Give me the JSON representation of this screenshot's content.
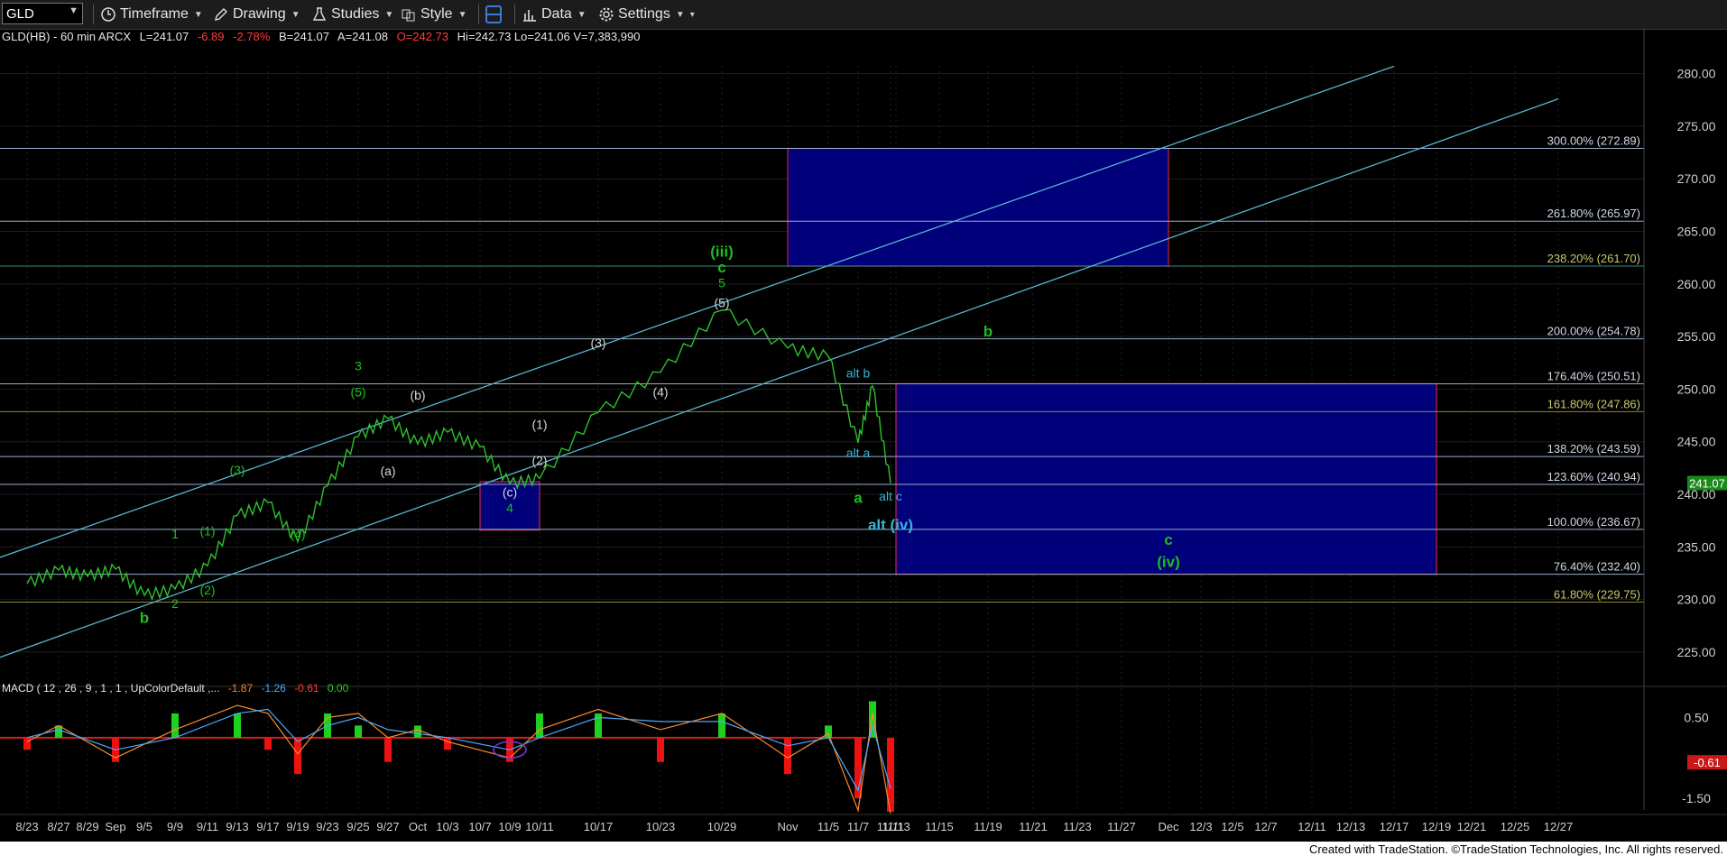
{
  "toolbar": {
    "symbol": "GLD",
    "timeframe": "Timeframe",
    "drawing": "Drawing",
    "studies": "Studies",
    "style": "Style",
    "data": "Data",
    "settings": "Settings"
  },
  "header": {
    "instrument": "GLD(HB) - 60 min  ARCX",
    "last": "L=241.07",
    "change": "-6.89",
    "pct": "-2.78%",
    "bid": "B=241.07",
    "ask": "A=241.08",
    "open": "O=242.73",
    "rest": "Hi=242.73  Lo=241.06  V=7,383,990"
  },
  "macd_header": {
    "name": "MACD ( 12 , 26 , 9 , 1 , 1 , UpColorDefault ,...",
    "v1": "-1.87",
    "v2": "-1.26",
    "v3": "-0.61",
    "v4": "0.00"
  },
  "colors": {
    "price_up": "#2dc12d",
    "fib_line": "#9aaecb",
    "box_fill": "#00007a",
    "box_border": "#cc2244",
    "wave_green": "#1fbd1f",
    "wave_cyan": "#36b6d8",
    "label_gray": "#d8d8d8",
    "macd_pos": "#1fd11f",
    "macd_neg": "#ee1111"
  },
  "chart_data": {
    "type": "line",
    "title": "GLD(HB) - 60 min",
    "ylim": [
      220,
      282
    ],
    "y_ticks": [
      225,
      230,
      235,
      240,
      245,
      250,
      255,
      260,
      265,
      270,
      275,
      280
    ],
    "x_ticks": [
      "8/23",
      "8/27",
      "8/29",
      "Sep",
      "9/5",
      "9/9",
      "9/11",
      "9/13",
      "9/17",
      "9/19",
      "9/23",
      "9/25",
      "9/27",
      "Oct",
      "10/3",
      "10/7",
      "10/9",
      "10/11",
      "10/17",
      "10/23",
      "10/29",
      "Nov",
      "11/5",
      "11/7",
      "11/11",
      "11/13",
      "11/15",
      "11/19",
      "11/21",
      "11/23",
      "11/27",
      "Dec",
      "12/3",
      "12/5",
      "12/7",
      "12/11",
      "12/13",
      "12/17",
      "12/19",
      "12/21",
      "12/25",
      "12/27"
    ],
    "last_price": "241.07",
    "price_path": [
      [
        "8/23",
        231.5
      ],
      [
        "8/27",
        232.8
      ],
      [
        "8/29",
        232.2
      ],
      [
        "Sep",
        232.9
      ],
      [
        "9/5",
        230.4
      ],
      [
        "9/9",
        231.0
      ],
      [
        "9/11",
        233.2
      ],
      [
        "9/13",
        238.0
      ],
      [
        "9/17",
        239.2
      ],
      [
        "9/19",
        235.5
      ],
      [
        "9/23",
        240.8
      ],
      [
        "9/25",
        245.5
      ],
      [
        "9/27",
        247.2
      ],
      [
        "Oct",
        244.8
      ],
      [
        "10/3",
        245.9
      ],
      [
        "10/7",
        244.5
      ],
      [
        "10/9",
        241.0
      ],
      [
        "10/11",
        241.5
      ],
      [
        "10/17",
        247.8
      ],
      [
        "10/23",
        251.6
      ],
      [
        "10/29",
        257.5
      ],
      [
        "Nov",
        253.9
      ],
      [
        "11/5",
        253.1
      ],
      [
        "11/7",
        244.9
      ],
      [
        "11/7",
        250.3
      ],
      [
        "11/11",
        241.07
      ]
    ],
    "fib_levels": [
      {
        "label": "300.00% (272.89)",
        "value": 272.89
      },
      {
        "label": "261.80% (265.97)",
        "value": 265.97
      },
      {
        "label": "238.20% (261.70)",
        "value": 261.7
      },
      {
        "label": "200.00% (254.78)",
        "value": 254.78
      },
      {
        "label": "176.40% (250.51)",
        "value": 250.51
      },
      {
        "label": "161.80% (247.86)",
        "value": 247.86
      },
      {
        "label": "138.20% (243.59)",
        "value": 243.59
      },
      {
        "label": "123.60% (240.94)",
        "value": 240.94
      },
      {
        "label": "100.00% (236.67)",
        "value": 236.67
      },
      {
        "label": "76.40% (232.40)",
        "value": 232.4
      },
      {
        "label": "61.80% (229.75)",
        "value": 229.75
      }
    ],
    "target_boxes": [
      {
        "from": "Nov",
        "to": "Dec",
        "low": 261.7,
        "high": 272.89
      },
      {
        "from": "11/13",
        "to": "12/19",
        "low": 232.4,
        "high": 250.51
      },
      {
        "from": "10/7",
        "to": "10/11",
        "low": 236.6,
        "high": 241.2
      }
    ],
    "channel_lines": [
      {
        "from": [
          "8/23",
          234
        ],
        "to": [
          "12/17",
          280.7
        ]
      },
      {
        "from": [
          "8/23",
          224.5
        ],
        "to": [
          "12/27",
          277.6
        ]
      }
    ],
    "wave_labels": [
      {
        "text": "b",
        "x": "9/5",
        "y": 227.8,
        "color": "green",
        "bold": true
      },
      {
        "text": "1",
        "x": "9/9",
        "y": 235.8,
        "color": "green",
        "bold": false
      },
      {
        "text": "2",
        "x": "9/9",
        "y": 229.2,
        "color": "green",
        "bold": false
      },
      {
        "text": "(1)",
        "x": "9/11",
        "y": 236.1,
        "color": "green",
        "bold": false
      },
      {
        "text": "(2)",
        "x": "9/11",
        "y": 230.5,
        "color": "green",
        "bold": false
      },
      {
        "text": "(3)",
        "x": "9/13",
        "y": 241.9,
        "color": "green",
        "bold": false
      },
      {
        "text": "(4)",
        "x": "9/19",
        "y": 235.8,
        "color": "green",
        "bold": false
      },
      {
        "text": "(5)",
        "x": "9/25",
        "y": 249.3,
        "color": "green",
        "bold": false
      },
      {
        "text": "3",
        "x": "9/25",
        "y": 251.8,
        "color": "green",
        "bold": false
      },
      {
        "text": "(a)",
        "x": "9/27",
        "y": 241.8,
        "color": "gray",
        "bold": false
      },
      {
        "text": "(b)",
        "x": "Oct",
        "y": 249.0,
        "color": "gray",
        "bold": false
      },
      {
        "text": "(c)",
        "x": "10/9",
        "y": 239.8,
        "color": "gray",
        "bold": false
      },
      {
        "text": "4",
        "x": "10/9",
        "y": 238.3,
        "color": "green",
        "bold": false
      },
      {
        "text": "(1)",
        "x": "10/11",
        "y": 246.2,
        "color": "gray",
        "bold": false
      },
      {
        "text": "(2)",
        "x": "10/11",
        "y": 242.8,
        "color": "gray",
        "bold": false
      },
      {
        "text": "(3)",
        "x": "10/17",
        "y": 254.0,
        "color": "gray",
        "bold": false
      },
      {
        "text": "(4)",
        "x": "10/23",
        "y": 249.3,
        "color": "gray",
        "bold": false
      },
      {
        "text": "(5)",
        "x": "10/29",
        "y": 257.8,
        "color": "gray",
        "bold": false
      },
      {
        "text": "5",
        "x": "10/29",
        "y": 259.7,
        "color": "green",
        "bold": false
      },
      {
        "text": "c",
        "x": "10/29",
        "y": 261.1,
        "color": "green",
        "bold": true
      },
      {
        "text": "(iii)",
        "x": "10/29",
        "y": 262.6,
        "color": "green",
        "bold": true
      },
      {
        "text": "alt b",
        "x": "11/7",
        "y": 251.1,
        "color": "cyan",
        "bold": false
      },
      {
        "text": "alt a",
        "x": "11/7",
        "y": 243.5,
        "color": "cyan",
        "bold": false
      },
      {
        "text": "a",
        "x": "11/7",
        "y": 239.2,
        "color": "green",
        "bold": true
      },
      {
        "text": "alt c",
        "x": "11/11",
        "y": 239.4,
        "color": "cyan",
        "bold": false
      },
      {
        "text": "alt (iv)",
        "x": "11/11",
        "y": 236.6,
        "color": "cyan",
        "bold": true
      },
      {
        "text": "b",
        "x": "11/19",
        "y": 255.0,
        "color": "green",
        "bold": true
      },
      {
        "text": "c",
        "x": "Dec",
        "y": 235.2,
        "color": "green",
        "bold": true
      },
      {
        "text": "(iv)",
        "x": "Dec",
        "y": 233.1,
        "color": "green",
        "bold": true
      }
    ],
    "macd": {
      "ylim": [
        -1.9,
        1.0
      ],
      "y_ticks": [
        0.5,
        -1.5
      ],
      "last_label": "-0.61",
      "macd_path": [
        [
          "8/23",
          -0.1
        ],
        [
          "8/27",
          0.3
        ],
        [
          "Sep",
          -0.5
        ],
        [
          "9/9",
          0.2
        ],
        [
          "9/13",
          0.8
        ],
        [
          "9/17",
          0.6
        ],
        [
          "9/19",
          -0.4
        ],
        [
          "9/23",
          0.5
        ],
        [
          "9/25",
          0.6
        ],
        [
          "9/27",
          0.0
        ],
        [
          "Oct",
          0.2
        ],
        [
          "10/3",
          -0.1
        ],
        [
          "10/9",
          -0.5
        ],
        [
          "10/11",
          0.2
        ],
        [
          "10/17",
          0.7
        ],
        [
          "10/23",
          0.2
        ],
        [
          "10/29",
          0.6
        ],
        [
          "Nov",
          -0.5
        ],
        [
          "11/5",
          0.1
        ],
        [
          "11/7",
          -1.8
        ],
        [
          "11/7",
          0.6
        ],
        [
          "11/11",
          -1.87
        ]
      ],
      "signal_path": [
        [
          "8/23",
          0.0
        ],
        [
          "8/27",
          0.2
        ],
        [
          "Sep",
          -0.3
        ],
        [
          "9/9",
          0.0
        ],
        [
          "9/13",
          0.6
        ],
        [
          "9/17",
          0.7
        ],
        [
          "9/19",
          -0.1
        ],
        [
          "9/23",
          0.3
        ],
        [
          "9/25",
          0.5
        ],
        [
          "9/27",
          0.2
        ],
        [
          "Oct",
          0.1
        ],
        [
          "10/3",
          0.0
        ],
        [
          "10/9",
          -0.3
        ],
        [
          "10/11",
          0.0
        ],
        [
          "10/17",
          0.5
        ],
        [
          "10/23",
          0.4
        ],
        [
          "10/29",
          0.4
        ],
        [
          "Nov",
          -0.2
        ],
        [
          "11/5",
          0.0
        ],
        [
          "11/7",
          -1.3
        ],
        [
          "11/7",
          0.3
        ],
        [
          "11/11",
          -1.26
        ]
      ]
    }
  },
  "footer": "Created with TradeStation. ©TradeStation Technologies, Inc. All rights reserved."
}
